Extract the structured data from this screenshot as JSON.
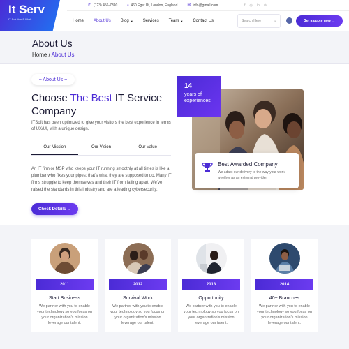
{
  "brand": {
    "name": "It Serv",
    "tagline": "IT Solution & Work"
  },
  "topbar": {
    "phone": "(123) 456-7890",
    "address": "460 Eget Ut, London, England",
    "email": "info@gmail.com",
    "socials": [
      "f",
      "◎",
      "in",
      "⊚"
    ]
  },
  "nav": {
    "items": [
      {
        "label": "Home"
      },
      {
        "label": "About Us"
      },
      {
        "label": "Blog"
      },
      {
        "label": "Services"
      },
      {
        "label": "Team"
      },
      {
        "label": "Contact Us"
      }
    ],
    "search_placeholder": "Search Here",
    "cta": "Get a quote now →"
  },
  "hero": {
    "title": "About Us",
    "crumb_home": "Home",
    "crumb_sep": " / ",
    "crumb_current": "About Us"
  },
  "about": {
    "tag": "~ About Us ~",
    "heading_pre": "Choose ",
    "heading_accent": "The Best",
    "heading_post": " IT Service Company",
    "lead": "ITSoft has been optimized to give your visitors the best experience in terms of UX/UI, with a unique design.",
    "tabs": [
      "Our Mission",
      "Our Vision",
      "Our Value"
    ],
    "body": "An IT firm or MSP who keeps your IT running smoothly at all times is like a plumber who fixes your pipes; that's what they are supposed to do. Many IT firms struggle to keep themselves and their IT from falling apart. We've raised the standards in this industry and are a leading cybersecurity.",
    "button": "Check Details →",
    "years_num": "14",
    "years_label": "years of experiences",
    "award_title": "Best Awarded Company",
    "award_desc": "We adapt our delivery to the way your work, whether as an external provider."
  },
  "features": [
    {
      "year": "2011",
      "title": "Start Business",
      "desc": "We partner with you to enable your technology so you focus on your organization's mission leverage our talent."
    },
    {
      "year": "2012",
      "title": "Survival Work",
      "desc": "We partner with you to enable your technology so you focus on your organization's mission leverage our talent."
    },
    {
      "year": "2013",
      "title": "Opportunity",
      "desc": "We partner with you to enable your technology so you focus on your organization's mission leverage our talent."
    },
    {
      "year": "2014",
      "title": "40+ Branches",
      "desc": "We partner with you to enable your technology so you focus on your organization's mission leverage our talent."
    }
  ],
  "colors": {
    "accent": "#4b2bd6",
    "hero_bg": "#f3f4f8"
  }
}
